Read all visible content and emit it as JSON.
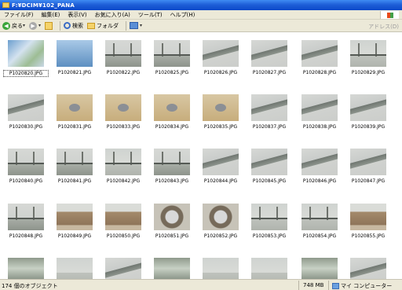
{
  "window": {
    "title": "F:¥DCIM¥102_PANA"
  },
  "menu": [
    "ファイル(F)",
    "編集(E)",
    "表示(V)",
    "お気に入り(A)",
    "ツール(T)",
    "ヘルプ(H)"
  ],
  "toolbar": {
    "back_label": "戻る",
    "search_label": "検索",
    "folders_label": "フォルダ",
    "address_label": "アドレス(D)"
  },
  "icons": {
    "back": "back-arrow-icon",
    "forward": "forward-arrow-icon",
    "up": "up-folder-icon",
    "search": "search-icon",
    "folders": "folders-icon",
    "views": "views-icon",
    "zone": "my-computer-icon"
  },
  "files": [
    "P1020820.JPG",
    "P1020821.JPG",
    "P1020822.JPG",
    "P1020825.JPG",
    "P1020826.JPG",
    "P1020827.JPG",
    "P1020828.JPG",
    "P1020829.JPG",
    "P1020830.JPG",
    "P1020831.JPG",
    "P1020833.JPG",
    "P1020834.JPG",
    "P1020835.JPG",
    "P1020837.JPG",
    "P1020838.JPG",
    "P1020839.JPG",
    "P1020840.JPG",
    "P1020841.JPG",
    "P1020842.JPG",
    "P1020843.JPG",
    "P1020844.JPG",
    "P1020845.JPG",
    "P1020846.JPG",
    "P1020847.JPG",
    "P1020848.JPG",
    "P1020849.JPG",
    "P1020850.JPG",
    "P1020851.JPG",
    "P1020852.JPG",
    "P1020853.JPG",
    "P1020854.JPG",
    "P1020855.JPG"
  ],
  "selected_file": "P1020820.JPG",
  "status": {
    "count": "174 個のオブジェクト",
    "size": "748 MB",
    "zone": "マイ コンピューター"
  }
}
